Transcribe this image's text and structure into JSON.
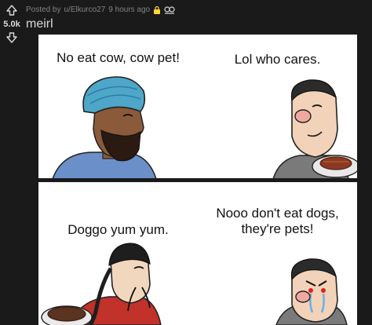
{
  "post": {
    "score": "5.0k",
    "posted_by_prefix": "Posted by",
    "username": "u/Elkurco27",
    "time_ago": "9 hours ago",
    "title": "meirl"
  },
  "icons": {
    "upvote": "arrow-up-icon",
    "downvote": "arrow-down-icon",
    "lock": "lock-icon",
    "mod": "mod-shield-icon"
  },
  "colors": {
    "background": "#1a1a1b",
    "text_primary": "#d7dadc",
    "text_meta": "#818384",
    "lock": "#ffd635"
  },
  "comic": {
    "panels": [
      {
        "caption": "No eat cow, cow pet!"
      },
      {
        "caption": "Lol who cares."
      },
      {
        "caption": "Doggo yum yum."
      },
      {
        "caption": "Nooo don't eat dogs, they're pets!"
      }
    ]
  }
}
